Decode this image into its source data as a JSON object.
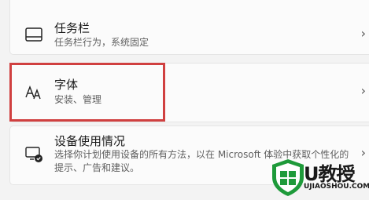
{
  "settings_items": [
    {
      "title": "任务栏",
      "subtitle": "任务栏行为，系统固定",
      "icon": "taskbar-icon"
    },
    {
      "title": "字体",
      "subtitle": "安装、管理",
      "icon": "fonts-icon"
    },
    {
      "title": "设备使用情况",
      "subtitle_line1": "选择你计划使用设备的所有方法，以在 Microsoft 体验中获取个性化的",
      "subtitle_line2": "提示、广告和建议。",
      "icon": "device-usage-icon"
    }
  ],
  "chevron": "›",
  "watermark": {
    "brand": "U教授",
    "url": "UJIAOSHOU.COM"
  },
  "colors": {
    "highlight": "#d04040",
    "watermark_green": "#1e9a3a"
  }
}
